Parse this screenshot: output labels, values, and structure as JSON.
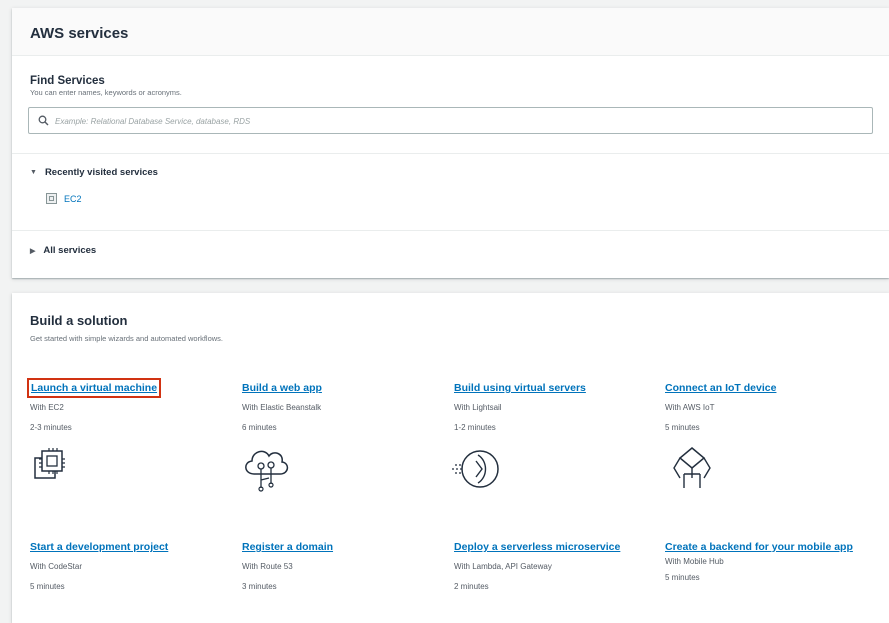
{
  "services": {
    "title": "AWS services",
    "find_title": "Find Services",
    "find_subtitle": "You can enter names, keywords or acronyms.",
    "search_placeholder": "Example: Relational Database Service, database, RDS",
    "recently_visited_label": "Recently visited services",
    "recent_items": [
      {
        "label": "EC2",
        "icon": "ec2-service-icon"
      }
    ],
    "all_services_label": "All services"
  },
  "solution": {
    "title": "Build a solution",
    "subtitle": "Get started with simple wizards and automated workflows.",
    "cards": [
      {
        "label": "Launch a virtual machine",
        "with": "With EC2",
        "time": "2-3 minutes",
        "icon": "virtual-machine-icon",
        "highlighted": true
      },
      {
        "label": "Build a web app",
        "with": "With Elastic Beanstalk",
        "time": "6 minutes",
        "icon": "cloud-tree-icon"
      },
      {
        "label": "Build using virtual servers",
        "with": "With Lightsail",
        "time": "1-2 minutes",
        "icon": "lightsail-icon"
      },
      {
        "label": "Connect an IoT device",
        "with": "With AWS IoT",
        "time": "5 minutes",
        "icon": "iot-device-icon"
      },
      {
        "label": "Start a development project",
        "with": "With CodeStar",
        "time": "5 minutes"
      },
      {
        "label": "Register a domain",
        "with": "With Route 53",
        "time": "3 minutes"
      },
      {
        "label": "Deploy a serverless microservice",
        "with": "With Lambda, API Gateway",
        "time": "2 minutes"
      },
      {
        "label": "Create a backend for your mobile app",
        "with": "With Mobile Hub",
        "time": "5 minutes"
      }
    ]
  },
  "colors": {
    "link": "#0073bb",
    "highlight": "#d13212",
    "heading": "#232f3e"
  }
}
